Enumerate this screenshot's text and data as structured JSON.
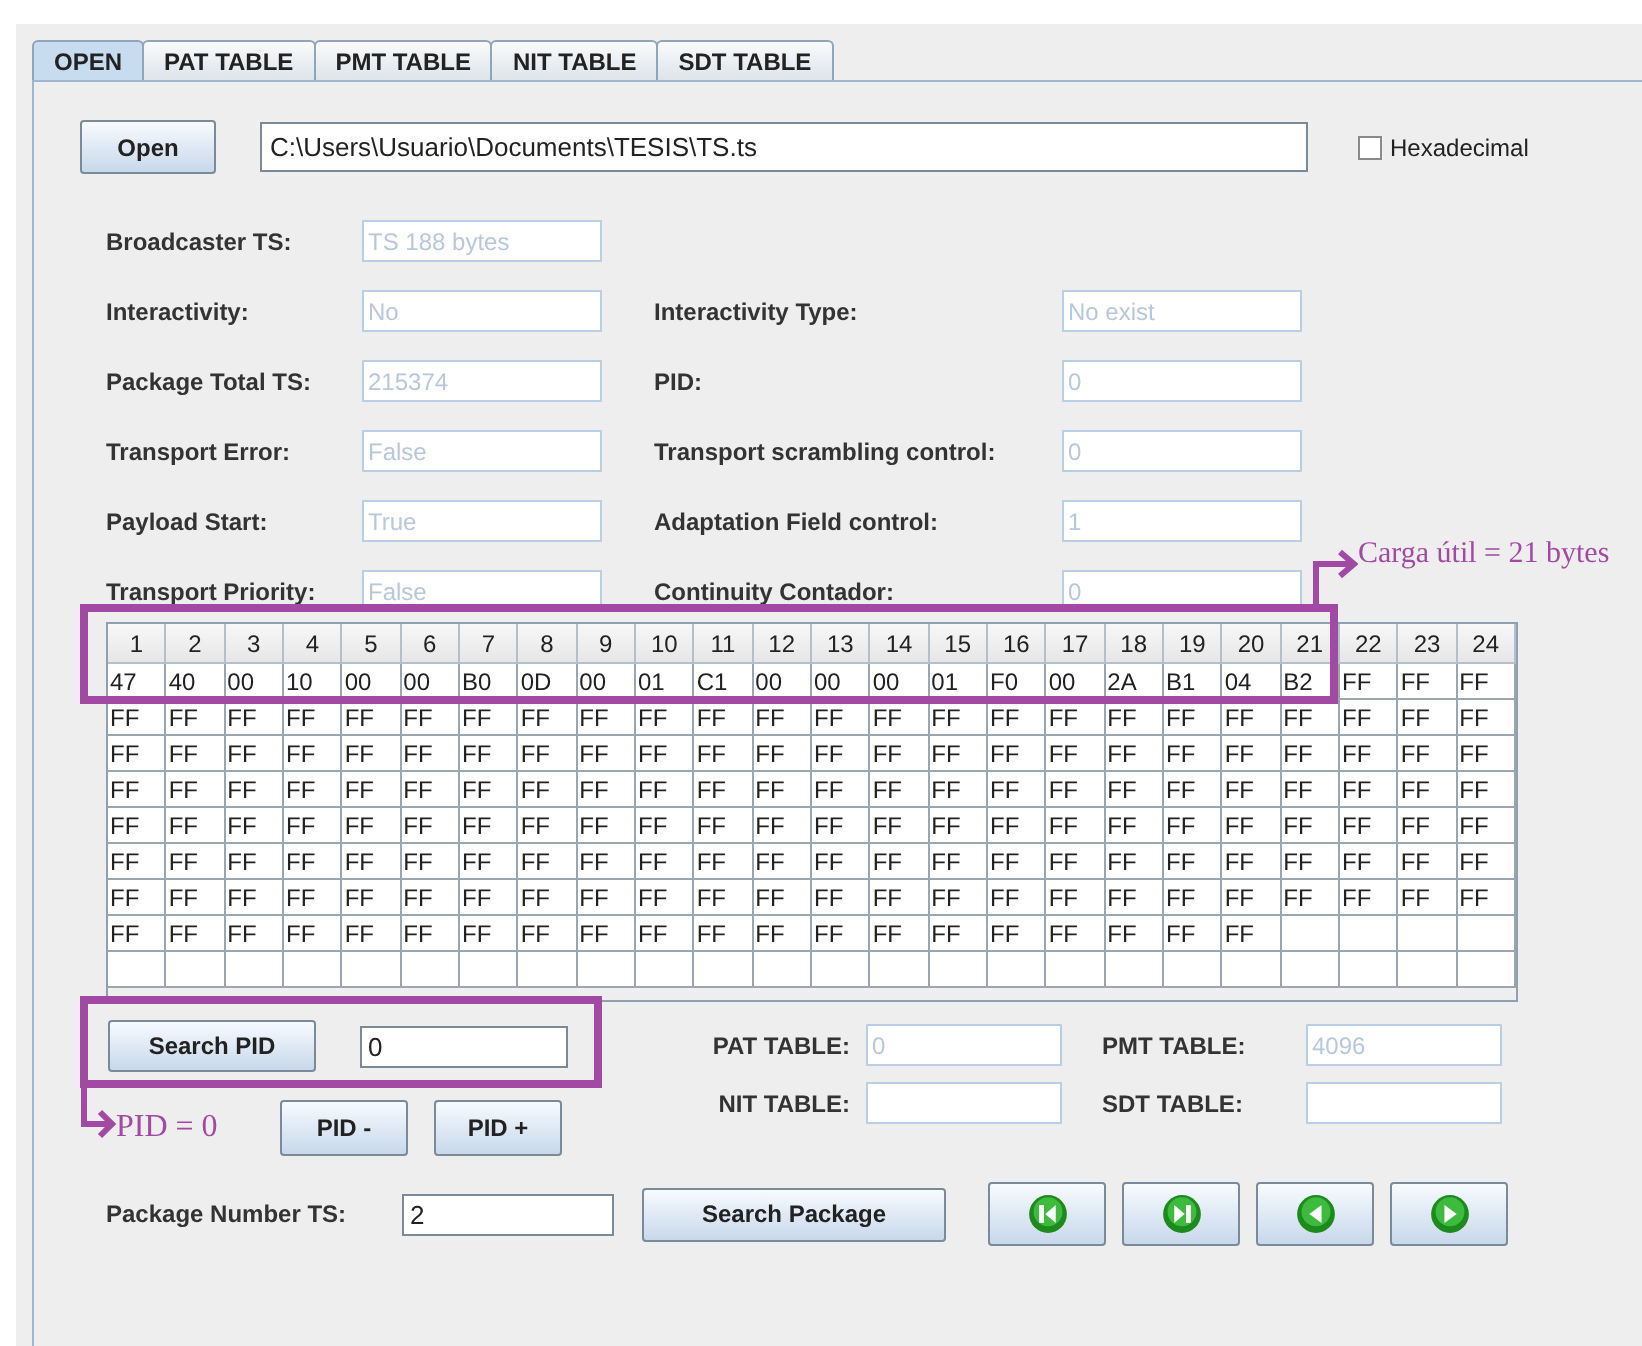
{
  "tabs": [
    {
      "label": "OPEN",
      "selected": true
    },
    {
      "label": "PAT TABLE",
      "selected": false
    },
    {
      "label": "PMT TABLE",
      "selected": false
    },
    {
      "label": "NIT TABLE",
      "selected": false
    },
    {
      "label": "SDT TABLE",
      "selected": false
    }
  ],
  "open_button": "Open",
  "file_path": "C:\\Users\\Usuario\\Documents\\TESIS\\TS.ts",
  "hexadecimal": {
    "label": "Hexadecimal",
    "checked": false
  },
  "info_rows": [
    {
      "left": {
        "label": "Broadcaster TS:",
        "value": "TS 188 bytes",
        "disabled": true
      }
    },
    {
      "left": {
        "label": "Interactivity:",
        "value": "No",
        "disabled": true
      },
      "right": {
        "label": "Interactivity Type:",
        "value": "No exist",
        "disabled": true
      }
    },
    {
      "left": {
        "label": "Package Total TS:",
        "value": "215374",
        "disabled": true
      },
      "right": {
        "label": "PID:",
        "value": "0",
        "disabled": true
      }
    },
    {
      "left": {
        "label": "Transport Error:",
        "value": "False",
        "disabled": true
      },
      "right": {
        "label": "Transport scrambling control:",
        "value": "0",
        "disabled": true
      }
    },
    {
      "left": {
        "label": "Payload Start:",
        "value": "True",
        "disabled": true
      },
      "right": {
        "label": "Adaptation Field control:",
        "value": "1",
        "disabled": true
      }
    },
    {
      "left": {
        "label": "Transport Priority:",
        "value": "False",
        "disabled": true
      },
      "right": {
        "label": "Continuity Contador:",
        "value": "0",
        "disabled": true
      }
    }
  ],
  "table": {
    "columns": [
      "1",
      "2",
      "3",
      "4",
      "5",
      "6",
      "7",
      "8",
      "9",
      "10",
      "11",
      "12",
      "13",
      "14",
      "15",
      "16",
      "17",
      "18",
      "19",
      "20",
      "21",
      "22",
      "23",
      "24"
    ],
    "rows": [
      [
        "47",
        "40",
        "00",
        "10",
        "00",
        "00",
        "B0",
        "0D",
        "00",
        "01",
        "C1",
        "00",
        "00",
        "00",
        "01",
        "F0",
        "00",
        "2A",
        "B1",
        "04",
        "B2",
        "FF",
        "FF",
        "FF"
      ],
      [
        "FF",
        "FF",
        "FF",
        "FF",
        "FF",
        "FF",
        "FF",
        "FF",
        "FF",
        "FF",
        "FF",
        "FF",
        "FF",
        "FF",
        "FF",
        "FF",
        "FF",
        "FF",
        "FF",
        "FF",
        "FF",
        "FF",
        "FF",
        "FF"
      ],
      [
        "FF",
        "FF",
        "FF",
        "FF",
        "FF",
        "FF",
        "FF",
        "FF",
        "FF",
        "FF",
        "FF",
        "FF",
        "FF",
        "FF",
        "FF",
        "FF",
        "FF",
        "FF",
        "FF",
        "FF",
        "FF",
        "FF",
        "FF",
        "FF"
      ],
      [
        "FF",
        "FF",
        "FF",
        "FF",
        "FF",
        "FF",
        "FF",
        "FF",
        "FF",
        "FF",
        "FF",
        "FF",
        "FF",
        "FF",
        "FF",
        "FF",
        "FF",
        "FF",
        "FF",
        "FF",
        "FF",
        "FF",
        "FF",
        "FF"
      ],
      [
        "FF",
        "FF",
        "FF",
        "FF",
        "FF",
        "FF",
        "FF",
        "FF",
        "FF",
        "FF",
        "FF",
        "FF",
        "FF",
        "FF",
        "FF",
        "FF",
        "FF",
        "FF",
        "FF",
        "FF",
        "FF",
        "FF",
        "FF",
        "FF"
      ],
      [
        "FF",
        "FF",
        "FF",
        "FF",
        "FF",
        "FF",
        "FF",
        "FF",
        "FF",
        "FF",
        "FF",
        "FF",
        "FF",
        "FF",
        "FF",
        "FF",
        "FF",
        "FF",
        "FF",
        "FF",
        "FF",
        "FF",
        "FF",
        "FF"
      ],
      [
        "FF",
        "FF",
        "FF",
        "FF",
        "FF",
        "FF",
        "FF",
        "FF",
        "FF",
        "FF",
        "FF",
        "FF",
        "FF",
        "FF",
        "FF",
        "FF",
        "FF",
        "FF",
        "FF",
        "FF",
        "FF",
        "FF",
        "FF",
        "FF"
      ],
      [
        "FF",
        "FF",
        "FF",
        "FF",
        "FF",
        "FF",
        "FF",
        "FF",
        "FF",
        "FF",
        "FF",
        "FF",
        "FF",
        "FF",
        "FF",
        "FF",
        "FF",
        "FF",
        "FF",
        "FF"
      ]
    ]
  },
  "search_pid": {
    "button": "Search PID",
    "value": "0"
  },
  "pid_buttons": [
    "PID -",
    "PID +"
  ],
  "table_fields": [
    [
      {
        "label": "PAT TABLE:",
        "value": "0",
        "disabled": true
      },
      {
        "label": "PMT TABLE:",
        "value": "4096",
        "disabled": true
      }
    ],
    [
      {
        "label": "NIT TABLE:",
        "disabled": true
      },
      {
        "label": "SDT TABLE:",
        "disabled": true
      }
    ]
  ],
  "package_number": {
    "label": "Package Number TS:",
    "value": "2"
  },
  "search_package": "Search Package",
  "nav_buttons": [
    {
      "kind": "skip_back"
    },
    {
      "kind": "skip_forward"
    },
    {
      "kind": "back"
    },
    {
      "kind": "forward"
    }
  ],
  "annotations": [
    {
      "kind": "table",
      "text": "Carga útil = 21 bytes",
      "color": "#a24aa3"
    },
    {
      "kind": "search",
      "text": "PID = 0",
      "color": "#a24aa3"
    }
  ]
}
